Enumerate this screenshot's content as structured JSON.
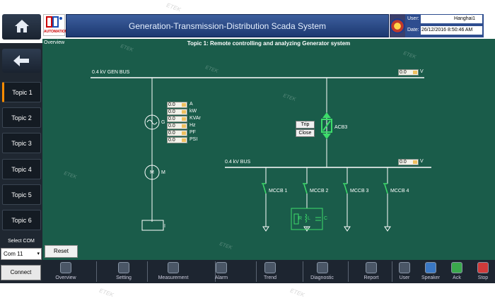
{
  "header": {
    "home_icon": "home-icon",
    "logo_text": "AUTOMATION",
    "title": "Generation-Transmission-Distribution Scada System",
    "user_label": "User:",
    "user_value": "Hanghai1",
    "date_label": "Date:",
    "date_value": "26/12/2016 8:50:46 AM"
  },
  "nav": {
    "back_icon": "arrow-left-icon",
    "topics": [
      "Topic 1",
      "Topic 2",
      "Topic 3",
      "Topic 4",
      "Topic 5",
      "Topic 6"
    ],
    "active_topic": "Topic 1",
    "select_com_label": "Select COM",
    "com_value": "Com 11",
    "connect_label": "Connect"
  },
  "main": {
    "page_name": "Overview",
    "topic_title": "Topic 1: Remote controlling and analyzing Generator system",
    "gen_bus_label": "0.4 kV GEN BUS",
    "gen_bus_value": "0.0",
    "gen_bus_unit": "V",
    "bus_label": "0.4 kV BUS",
    "bus_value": "0.0",
    "bus_unit": "V",
    "generator_label": "G",
    "motor_label": "M",
    "box_label": "I",
    "measurements": [
      {
        "value": "0.0",
        "unit": "A"
      },
      {
        "value": "0.0",
        "unit": "kW"
      },
      {
        "value": "0.0",
        "unit": "KVAr"
      },
      {
        "value": "0.0",
        "unit": "Hz"
      },
      {
        "value": "0.0",
        "unit": "PF"
      },
      {
        "value": "0.0",
        "unit": "PSI"
      }
    ],
    "trip_label": "Trip",
    "close_label": "Close",
    "acb_label": "ACB3",
    "mccbs": [
      "MCCB 1",
      "MCCB 2",
      "MCCB 3",
      "MCCB 4"
    ],
    "load_r": "R",
    "load_l": "L",
    "load_c": "C",
    "reset_label": "Reset",
    "watermark": "ETEK"
  },
  "toolbar": {
    "left": [
      {
        "label": "Overview",
        "icon": "overview-icon"
      },
      {
        "label": "Setting",
        "icon": "gear-icon"
      },
      {
        "label": "Measurement",
        "icon": "gauge-icon"
      },
      {
        "label": "Alarm",
        "icon": "alarm-icon"
      },
      {
        "label": "Trend",
        "icon": "trend-chart-icon"
      },
      {
        "label": "Diagnostic",
        "icon": "diagnostic-icon"
      },
      {
        "label": "Report",
        "icon": "report-document-icon"
      }
    ],
    "right": [
      {
        "label": "User",
        "icon": "user-icon"
      },
      {
        "label": "Speaker",
        "icon": "speaker-icon"
      },
      {
        "label": "Ack",
        "icon": "acknowledge-icon"
      },
      {
        "label": "Stop",
        "icon": "stop-icon"
      }
    ]
  },
  "colors": {
    "canvas": "#1a5c4a",
    "nav": "#1f2731",
    "title_bar": "#2e4d8f",
    "active_topic_accent": "#ff8c00",
    "breaker": "#3ddc6a"
  }
}
